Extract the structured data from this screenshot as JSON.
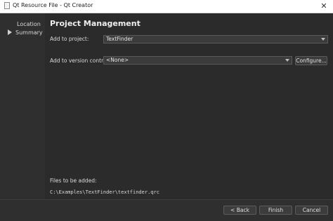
{
  "window": {
    "title": "Qt Resource File - Qt Creator",
    "close_glyph": "✕"
  },
  "sidebar": {
    "items": [
      {
        "label": "Location",
        "current": false
      },
      {
        "label": "Summary",
        "current": true
      }
    ]
  },
  "page": {
    "title": "Project Management",
    "add_to_project": {
      "label": "Add to project:",
      "value": "TextFinder"
    },
    "add_to_version_control": {
      "label": "Add to version control:",
      "value": "<None>",
      "configure_label": "Configure..."
    },
    "files_to_be_added": {
      "label": "Files to be added:",
      "files": [
        "C:\\Examples\\TextFinder\\textfinder.qrc"
      ]
    }
  },
  "footer": {
    "back_label": "< Back",
    "finish_label": "Finish",
    "cancel_label": "Cancel"
  },
  "colors": {
    "background": "#2b2b2b",
    "sidebar": "#2f2f30",
    "text": "#d8d8d8"
  }
}
